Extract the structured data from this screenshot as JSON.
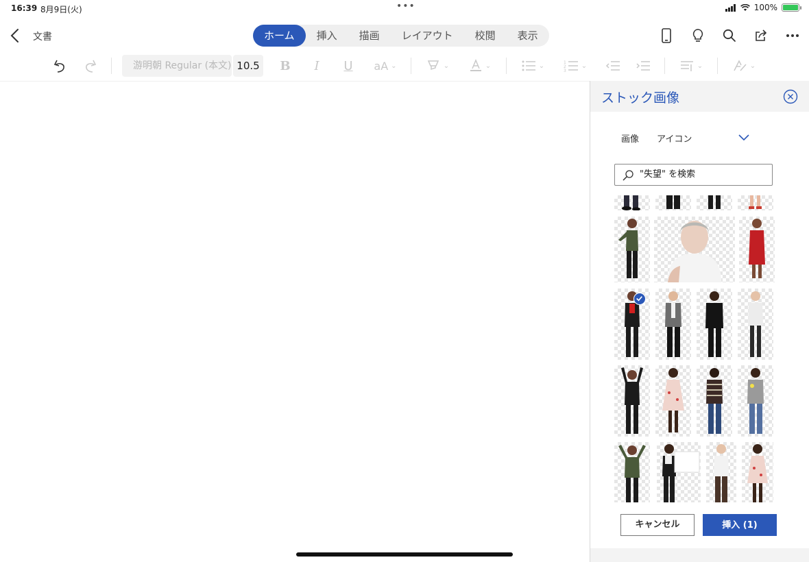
{
  "status": {
    "time": "16:39",
    "date": "8月9日(火)",
    "battery_text": "100%",
    "battery_level": 1.0
  },
  "topbar": {
    "doc_title": "文書",
    "tabs": [
      "ホーム",
      "挿入",
      "描画",
      "レイアウト",
      "校閲",
      "表示"
    ],
    "active_tab": "ホーム",
    "icons": [
      "phone-view-icon",
      "lightbulb-icon",
      "search-icon",
      "share-icon",
      "more-icon"
    ]
  },
  "toolbar": {
    "font_name": "游明朝 Regular (本文)",
    "font_size": "10.5",
    "icons": [
      "undo-icon",
      "redo-icon",
      "bold-icon",
      "italic-icon",
      "underline-icon",
      "font-size-icon",
      "highlight-icon",
      "font-color-icon",
      "bullets-icon",
      "numbering-icon",
      "decrease-indent-icon",
      "increase-indent-icon",
      "paragraph-icon",
      "styles-icon"
    ]
  },
  "panel": {
    "title": "ストック画像",
    "filter_images": "画像",
    "filter_icons": "アイコン",
    "search_value": "\"失望\" を検索",
    "cancel_label": "キャンセル",
    "insert_label": "挿入 (1)",
    "accent": "#2b58b8"
  }
}
